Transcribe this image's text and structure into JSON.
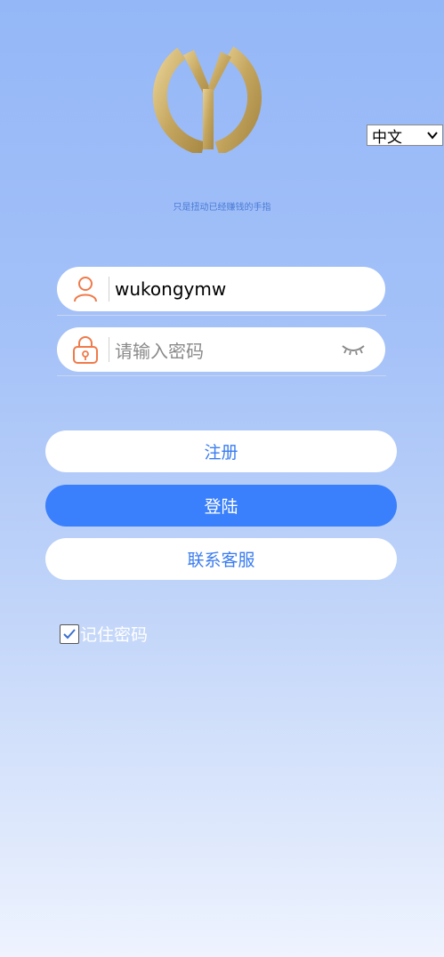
{
  "language_select": {
    "selected": "中文"
  },
  "slogan": "只是扭动已经赚钱的手指",
  "username_field": {
    "value": "wukongymw"
  },
  "password_field": {
    "placeholder": "请输入密码"
  },
  "buttons": {
    "register": "注册",
    "login": "登陆",
    "customer_service": "联系客服"
  },
  "remember_password": {
    "label": "记住密码",
    "checked": true
  },
  "icons": {
    "user": "user-icon",
    "lock": "lock-icon",
    "eye": "eye-closed-icon",
    "logo": "y-logo-icon"
  },
  "colors": {
    "accent": "#3a7ffb",
    "icon_orange": "#f07a4a",
    "logo_gold": "#c8a860"
  }
}
